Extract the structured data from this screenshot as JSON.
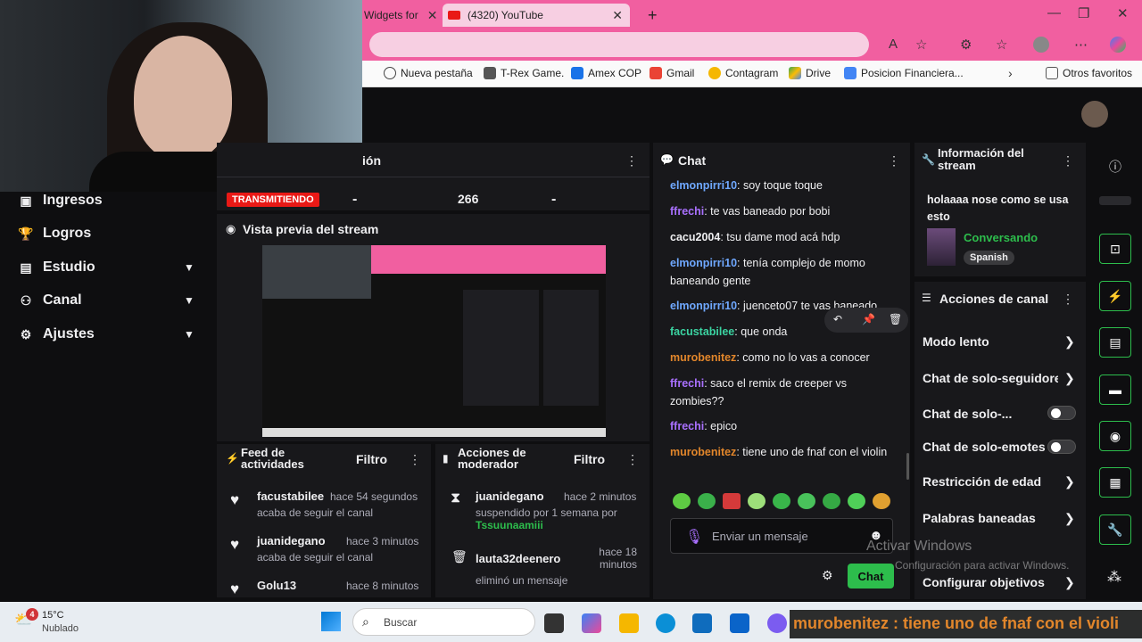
{
  "browser": {
    "tabs": [
      {
        "label": "Widgets for"
      },
      {
        "label": "(4320) YouTube"
      }
    ],
    "new_tab": "+",
    "bookmarks": [
      "Nueva pestaña",
      "T-Rex Game.",
      "Amex COP",
      "Gmail",
      "Contagram",
      "Drive",
      "Posicion Financiera...",
      "Otros favoritos"
    ]
  },
  "sidebar": {
    "items": [
      {
        "label": "Ingresos",
        "icon": "revenue-icon"
      },
      {
        "label": "Logros",
        "icon": "trophy-icon"
      },
      {
        "label": "Estudio",
        "icon": "studio-icon",
        "expandable": true
      },
      {
        "label": "Canal",
        "icon": "channel-icon",
        "expandable": true
      },
      {
        "label": "Ajustes",
        "icon": "gear-icon",
        "expandable": true
      }
    ]
  },
  "stats": {
    "title_fragment": "ión",
    "live_badge": "TRANSMITIENDO",
    "values": [
      "-",
      "266",
      "-"
    ]
  },
  "preview": {
    "title": "Vista previa del stream"
  },
  "chat": {
    "title": "Chat",
    "messages": [
      {
        "user": "elmonpirri10",
        "text": ": soy toque toque",
        "color": "#6fa8ff"
      },
      {
        "user": "ffrechi",
        "text": ": te vas baneado por bobi",
        "color": "#a970ff"
      },
      {
        "user": "cacu2004",
        "text": ": tsu dame mod acá hdp",
        "color": "#efeff1"
      },
      {
        "user": "elmonpirri10",
        "text": ": tenía complejo de momo baneando gente",
        "color": "#6fa8ff"
      },
      {
        "user": "elmonpirri10",
        "text": ": juenceto07 te vas baneado",
        "color": "#6fa8ff"
      },
      {
        "user": "facustabilee",
        "text": ": que onda",
        "color": "#3bd3a1"
      },
      {
        "user": "murobenitez",
        "text": ": como no lo vas a conocer",
        "color": "#e2862b"
      },
      {
        "user": "ffrechi",
        "text": ": saco el remix de creeper vs zombies??",
        "color": "#a970ff"
      },
      {
        "user": "ffrechi",
        "text": ": epico",
        "color": "#a970ff"
      },
      {
        "user": "murobenitez",
        "text": ": tiene uno de fnaf con el violin",
        "color": "#e2862b"
      }
    ],
    "input_placeholder": "Enviar un mensaje",
    "send_label": "Chat"
  },
  "feed": {
    "title": "Feed de actividades",
    "filter": "Filtro",
    "items": [
      {
        "user": "facustabilee",
        "time": "hace 54 segundos",
        "action": "acaba de seguir el canal"
      },
      {
        "user": "juanidegano",
        "time": "hace 3 minutos",
        "action": "acaba de seguir el canal"
      },
      {
        "user": "Golu13",
        "time": "hace 8 minutos",
        "action": ""
      }
    ]
  },
  "modactions": {
    "title": "Acciones de moderador",
    "filter": "Filtro",
    "items": [
      {
        "user": "juanidegano",
        "time": "hace 2 minutos",
        "action": "suspendido por 1 semana por",
        "by": "Tssuunaamiii"
      },
      {
        "user": "lauta32deenero",
        "time": "hace 18 minutos",
        "action": "eliminó un mensaje",
        "by": ""
      }
    ]
  },
  "streaminfo": {
    "title": "Información del stream",
    "stream_title": "holaaaa nose como se usa esto",
    "category": "Conversando",
    "language": "Spanish"
  },
  "channelactions": {
    "title": "Acciones de canal",
    "items": [
      {
        "label": "Modo lento",
        "type": "chevron"
      },
      {
        "label": "Chat de solo-seguidores",
        "type": "chevron"
      },
      {
        "label": "Chat de solo-...",
        "type": "toggle"
      },
      {
        "label": "Chat de solo-emotes",
        "type": "toggle"
      },
      {
        "label": "Restricción de edad",
        "type": "chevron"
      },
      {
        "label": "Palabras baneadas",
        "type": "chevron"
      },
      {
        "label": "Configurar objetivos",
        "type": "chevron"
      }
    ]
  },
  "watermark": {
    "line1": "Activar Windows",
    "line2": "Configuración para activar Windows."
  },
  "taskbar": {
    "temp": "15°C",
    "weather": "Nublado",
    "search": "Buscar",
    "badge": "4",
    "overlay": "murobenitez : tiene uno de fnaf con el violi"
  },
  "colors": {
    "accent": "#2dbd4c",
    "live": "#e91916",
    "tabbar": "#f15fa0",
    "bg": "#0e0e10",
    "panel": "#18181b"
  }
}
